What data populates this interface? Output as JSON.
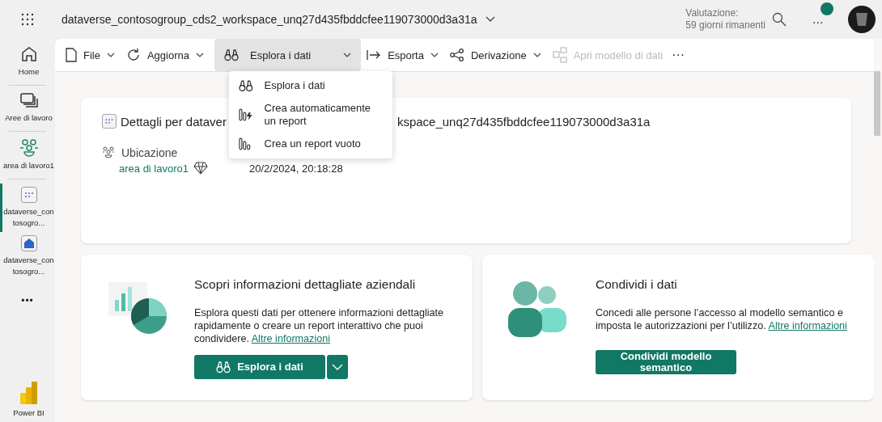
{
  "header": {
    "title": "dataverse_contosogroup_cds2_workspace_unq27d435fbddcfee119073000d3a31a",
    "trial": [
      "Valutazione:",
      "59 giorni rimanenti"
    ],
    "more": "..."
  },
  "sidebar": {
    "items": [
      {
        "label": "Home",
        "kind": "home",
        "selected": false
      },
      {
        "label": "Aree di lavoro",
        "kind": "workspaces",
        "selected": false
      },
      {
        "label": "area di lavoro1",
        "kind": "workspace",
        "selected": false
      },
      {
        "label": "dataverse_contosogro...",
        "kind": "dataset",
        "selected": true
      },
      {
        "label": "dataverse_contosogro...",
        "kind": "semantic",
        "selected": false
      }
    ],
    "more": "•••",
    "footer": "Power BI"
  },
  "toolbar": {
    "items": [
      {
        "label": "File",
        "kind": "file",
        "dropdown": true,
        "selected": false,
        "disabled": false
      },
      {
        "label": "Aggiorna",
        "kind": "refresh",
        "dropdown": true,
        "selected": false,
        "disabled": false
      },
      {
        "label": "Esplora i dati",
        "kind": "explore",
        "dropdown": true,
        "selected": true,
        "disabled": false
      },
      {
        "label": "Esporta",
        "kind": "export",
        "dropdown": true,
        "selected": false,
        "disabled": false
      },
      {
        "label": "Derivazione",
        "kind": "lineage",
        "dropdown": true,
        "selected": false,
        "disabled": false
      },
      {
        "label": "Apri modello di dati",
        "kind": "model",
        "dropdown": false,
        "selected": false,
        "disabled": true
      }
    ],
    "more": "···"
  },
  "menu": {
    "items": [
      {
        "label": "Esplora i dati",
        "kind": "explore"
      },
      {
        "label": "Crea automaticamente un report",
        "kind": "auto"
      },
      {
        "label": "Crea un report vuoto",
        "kind": "blank"
      }
    ]
  },
  "details": {
    "title_parts": [
      "Dettagli per dataver",
      "kspace_unq27d435fbddcfee119073000d3a31a"
    ],
    "location_label": "Ubicazione",
    "location_link": "area di lavoro1",
    "date": "20/2/2024, 20:18:28"
  },
  "cards": [
    {
      "kind": "insights",
      "title": "Scopri informazioni dettagliate aziendali",
      "text": "Esplora questi dati per ottenere informazioni dettagliate rapidamente o creare un report interattivo che puoi condividere.",
      "link": "Altre informazioni",
      "button": "Esplora i dati",
      "split": true
    },
    {
      "kind": "share",
      "title": "Condividi i dati",
      "text": "Concedi alle persone l’accesso al modello semantico e imposta le autorizzazioni per l’utilizzo.",
      "link": "Altre informazioni",
      "button": "Condividi modello semantico",
      "split": false
    }
  ]
}
